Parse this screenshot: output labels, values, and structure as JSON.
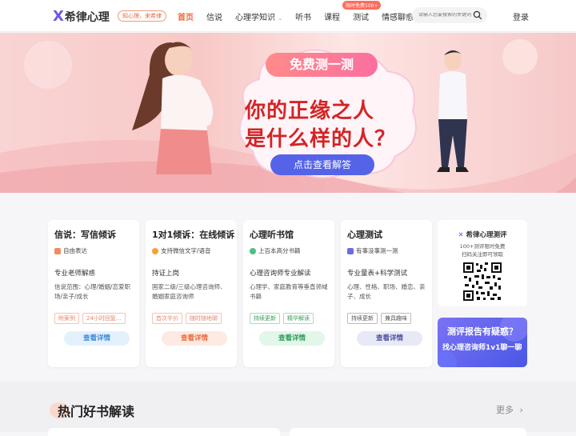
{
  "header": {
    "logo_mark": "X",
    "logo_text": "希律心理",
    "slogan": "知心理，来希律",
    "nav": [
      "首页",
      "信说",
      "心理学知识",
      "听书",
      "课程",
      "测试",
      "情感聊愈"
    ],
    "badge": "限时免费100+",
    "search_placeholder": "请输入您要搜索的关键词",
    "login": "登录"
  },
  "banner": {
    "top_label": "免费测一测",
    "line1": "你的正缘之人",
    "line2": "是什么样的人？",
    "cta": "点击查看解答"
  },
  "cards": [
    {
      "title": "信说：写信倾诉",
      "sub": "自由表达",
      "head": "专业老师解惑",
      "desc": "信说范围：心理/婚姻/恋爱职场/亲子/成长",
      "tags": [
        "附案例",
        "24小时回复..."
      ],
      "button": "查看详情"
    },
    {
      "title": "1对1倾诉：在线倾诉",
      "sub": "支持微信文字/语音",
      "head": "持证上岗",
      "desc": "国家二级/三级心理咨询师、婚姻家庭咨询师",
      "tags": [
        "首次半价",
        "随时随地聊"
      ],
      "button": "查看详情"
    },
    {
      "title": "心理听书馆",
      "sub": "上百本高分书籍",
      "head": "心理咨询师专业解读",
      "desc": "心理学、家庭教育等垂直领域书籍",
      "tags": [
        "持续更新",
        "精华解读"
      ],
      "button": "查看详情"
    },
    {
      "title": "心理测试",
      "sub": "有事没事测一测",
      "head": "专业量表+科学测试",
      "desc": "心理、性格、职场、婚恋、亲子、成长",
      "tags": [
        "持续更新",
        "兼具趣味"
      ],
      "button": "查看详情"
    }
  ],
  "qr": {
    "title": "希律心理测评",
    "line1": "100+测评限时免费",
    "line2": "扫码关注即可领取"
  },
  "promo": {
    "line1": "测评报告有疑惑？",
    "line2": "找心理咨询师1v1聊一聊"
  },
  "books": {
    "title": "热门好书解读",
    "more": "更多"
  },
  "colors": {
    "accent": "#f06a3c",
    "primary": "#5463e8"
  }
}
